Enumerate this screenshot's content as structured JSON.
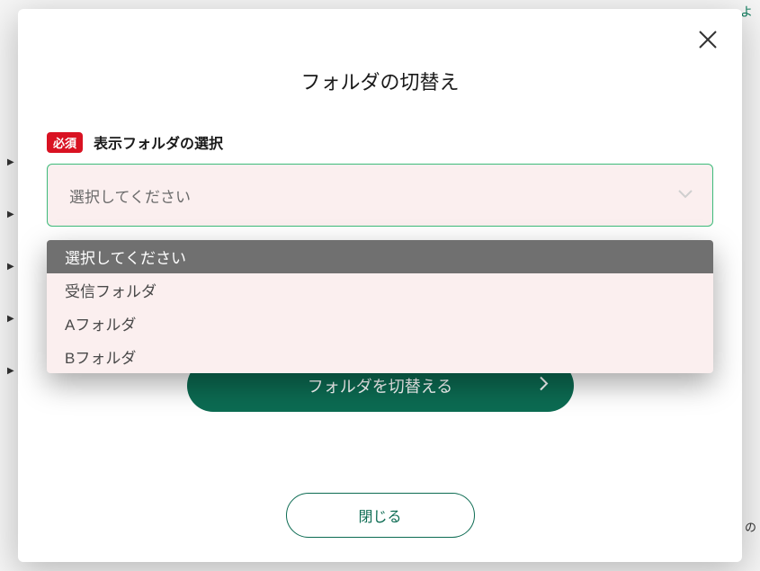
{
  "modal": {
    "title": "フォルダの切替え",
    "required_badge": "必須",
    "field_label": "表示フォルダの選択",
    "select": {
      "placeholder": "選択してください",
      "options": [
        "選択してください",
        "受信フォルダ",
        "Aフォルダ",
        "Bフォルダ"
      ],
      "highlighted_index": 0
    },
    "submit_label": "フォルダを切替える",
    "close_label": "閉じる"
  },
  "background": {
    "top_right_text": "よ",
    "bottom_right_text": "の"
  }
}
